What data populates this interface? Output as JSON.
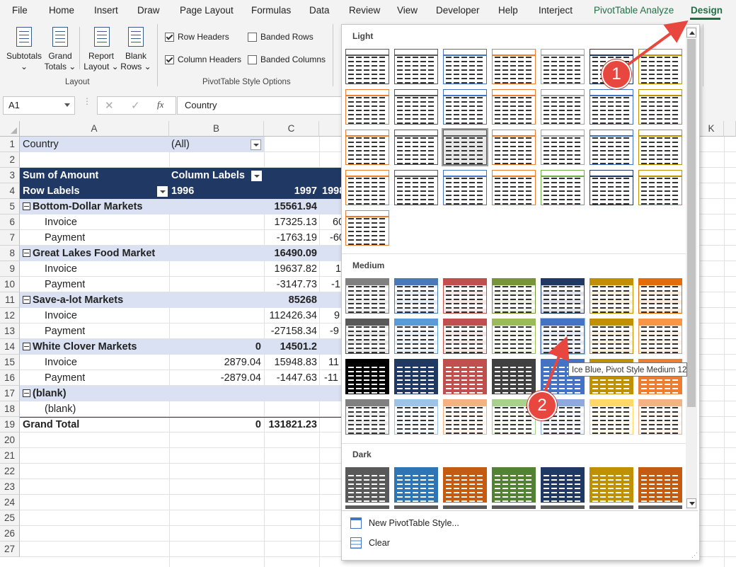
{
  "menu": [
    "File",
    "Home",
    "Insert",
    "Draw",
    "Page Layout",
    "Formulas",
    "Data",
    "Review",
    "View",
    "Developer",
    "Help",
    "Interject",
    "PivotTable Analyze",
    "Design"
  ],
  "ribbon": {
    "subtotals": [
      "Subtotals",
      "⌄"
    ],
    "grand_totals": [
      "Grand",
      "Totals ⌄"
    ],
    "report_layout": [
      "Report",
      "Layout ⌄"
    ],
    "blank_rows": [
      "Blank",
      "Rows ⌄"
    ],
    "layout_group": "Layout",
    "row_headers": "Row Headers",
    "column_headers": "Column Headers",
    "banded_rows": "Banded Rows",
    "banded_columns": "Banded Columns",
    "options_group": "PivotTable Style Options"
  },
  "formula_bar": {
    "name_box": "A1",
    "cancel": "✕",
    "enter": "✓",
    "fx": "fx",
    "formula": "Country"
  },
  "columns": [
    "A",
    "B",
    "C",
    "K"
  ],
  "rows": [
    "1",
    "2",
    "3",
    "4",
    "5",
    "6",
    "7",
    "8",
    "9",
    "10",
    "11",
    "12",
    "13",
    "14",
    "15",
    "16",
    "17",
    "18",
    "19",
    "20",
    "21",
    "22",
    "23",
    "24",
    "25",
    "26",
    "27"
  ],
  "pivot": {
    "filter_label": "Country",
    "filter_value": "(All)",
    "sum_label": "Sum of Amount",
    "col_labels": "Column Labels",
    "row_labels": "Row Labels",
    "y1996": "1996",
    "y1997": "1997",
    "y1998": "1998",
    "r5": {
      "label": "Bottom-Dollar Markets",
      "c": "15561.94"
    },
    "r6": {
      "label": "Invoice",
      "c": "17325.13",
      "d": "60"
    },
    "r7": {
      "label": "Payment",
      "c": "-1763.19",
      "d": "-60"
    },
    "r8": {
      "label": "Great Lakes Food Market",
      "c": "16490.09"
    },
    "r9": {
      "label": "Invoice",
      "c": "19637.82",
      "d": "1"
    },
    "r10": {
      "label": "Payment",
      "c": "-3147.73",
      "d": "-1"
    },
    "r11": {
      "label": "Save-a-lot Markets",
      "c": "85268"
    },
    "r12": {
      "label": "Invoice",
      "c": "112426.34",
      "d": "9"
    },
    "r13": {
      "label": "Payment",
      "c": "-27158.34",
      "d": "-9"
    },
    "r14": {
      "label": "White Clover Markets",
      "b": "0",
      "c": "14501.2"
    },
    "r15": {
      "label": "Invoice",
      "b": "2879.04",
      "c": "15948.83",
      "d": "11"
    },
    "r16": {
      "label": "Payment",
      "b": "-2879.04",
      "c": "-1447.63",
      "d": "-11"
    },
    "r17": {
      "label": "(blank)"
    },
    "r18": {
      "label": "(blank)"
    },
    "r19": {
      "label": "Grand Total",
      "b": "0",
      "c": "131821.23"
    }
  },
  "gallery": {
    "light": "Light",
    "medium": "Medium",
    "dark": "Dark",
    "new_style": "New PivotTable Style...",
    "clear": "Clear",
    "tooltip": "Ice Blue, Pivot Style Medium 12",
    "light_colors": [
      "#595959",
      "#595959",
      "#4472c4",
      "#ed7d31",
      "#a5a5a5",
      "#1f3864",
      "#bf9000",
      "#ed7d31",
      "#595959",
      "#4472c4",
      "#ed7d31",
      "#a5a5a5",
      "#4472c4",
      "#bf9000",
      "#ed7d31",
      "#595959",
      "#595959",
      "#ed7d31",
      "#a5a5a5",
      "#4472c4",
      "#bf9000",
      "#ed7d31",
      "#595959",
      "#4472c4",
      "#ed7d31",
      "#70ad47",
      "#1f3864",
      "#bf9000",
      "#ed7d31"
    ],
    "medium_colors": [
      "#808080",
      "#4a7ab5",
      "#c0504d",
      "#77933c",
      "#1f3864",
      "#bf9000",
      "#e36c09",
      "#595959",
      "#5b9bd5",
      "#c0504d",
      "#9bbb59",
      "#4472c4",
      "#bf9000",
      "#f79646",
      "#000000",
      "#1f3864",
      "#c0504d",
      "#404040",
      "#4472c4",
      "#bf9000",
      "#ed7d31",
      "#808080",
      "#9dc3e6",
      "#f4b183",
      "#a9d18e",
      "#8ea9db",
      "#ffd966",
      "#f4b183"
    ],
    "dark_colors": [
      "#595959",
      "#2e75b6",
      "#c55a11",
      "#548235",
      "#203864",
      "#bf9000",
      "#c55a11"
    ]
  },
  "callouts": [
    "1",
    "2"
  ]
}
